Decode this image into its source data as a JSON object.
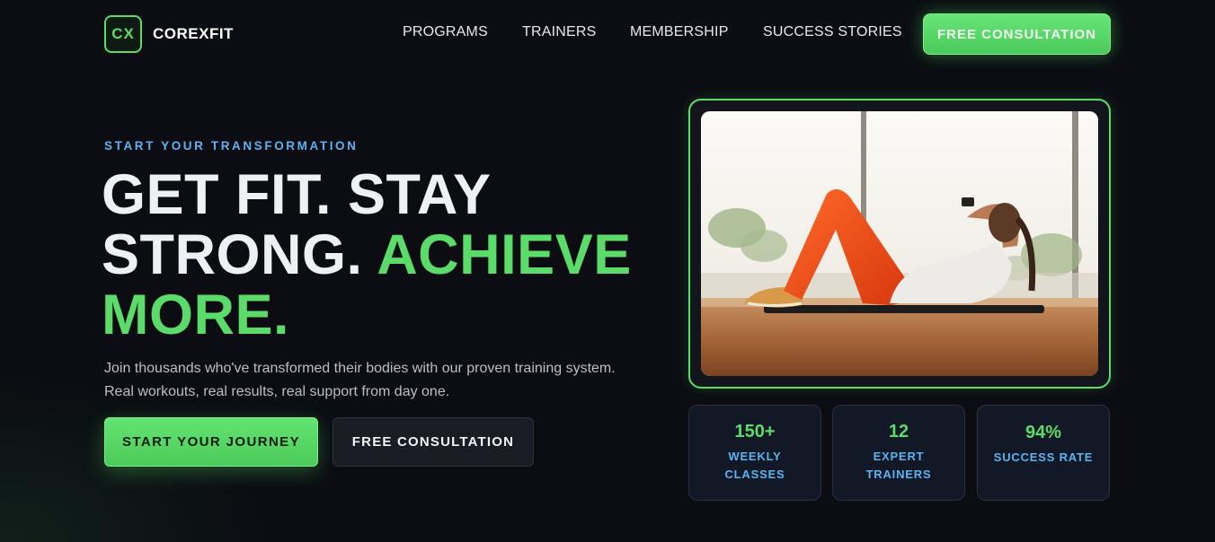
{
  "brand": {
    "mark": "CX",
    "name": "COREXFIT"
  },
  "nav": {
    "items": [
      "PROGRAMS",
      "TRAINERS",
      "MEMBERSHIP",
      "SUCCESS STORIES"
    ],
    "cta": "FREE CONSULTATION"
  },
  "hero": {
    "eyebrow": "START YOUR TRANSFORMATION",
    "headline_part1": "GET FIT. STAY STRONG.",
    "headline_accent": "ACHIEVE MORE.",
    "description": "Join thousands who've transformed their bodies with our proven training system. Real workouts, real results, real support from day one.",
    "primary_button": "START YOUR JOURNEY",
    "secondary_button": "FREE CONSULTATION"
  },
  "stats": [
    {
      "value": "150+",
      "label": "WEEKLY CLASSES"
    },
    {
      "value": "12",
      "label": "EXPERT TRAINERS"
    },
    {
      "value": "94%",
      "label": "SUCCESS RATE"
    }
  ],
  "colors": {
    "background": "#0b0d12",
    "accent_green": "#5bdc6a",
    "accent_blue": "#58b4f2",
    "card_bg": "#131826"
  },
  "icons": {
    "logo": "cx-logo-mark",
    "hero_image": "woman-doing-crunches-photo"
  }
}
